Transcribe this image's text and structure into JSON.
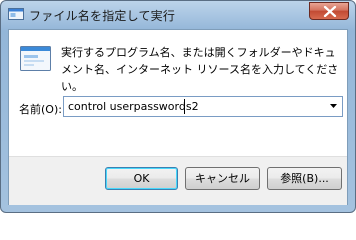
{
  "window": {
    "title": "ファイル名を指定して実行"
  },
  "dialog": {
    "description": "実行するプログラム名、または開くフォルダーやドキュメント名、インターネット リソース名を入力してください。",
    "open_label": "名前(O):",
    "open_value": "control userpasswords2"
  },
  "buttons": {
    "ok": "OK",
    "cancel": "キャンセル",
    "browse": "参照(B)..."
  },
  "icons": {
    "title_icon": "run-icon",
    "dialog_icon": "run-icon",
    "close": "close-icon",
    "dropdown": "chevron-down-icon"
  },
  "colors": {
    "title_bar": "#a9c6e2",
    "close_button": "#c24a33",
    "footer": "#f0f0f0",
    "default_button_border": "#3c7fb1"
  }
}
